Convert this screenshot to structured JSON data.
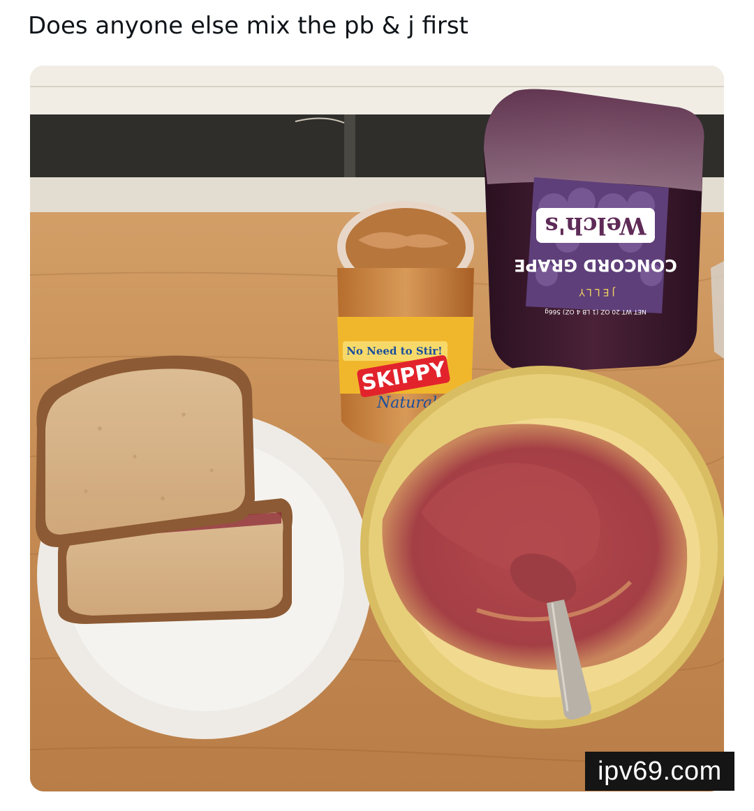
{
  "post": {
    "text": "Does anyone else mix the pb & j first"
  },
  "photo": {
    "jelly_brand": "Welch's",
    "jelly_variety": "CONCORD GRAPE",
    "jelly_type": "JELLY",
    "jelly_weight": "NET WT 20 OZ (1 LB 4 OZ) 566g",
    "pb_tagline": "No Need to Stir!",
    "pb_brand": "SKIPPY",
    "pb_variety": "Natural"
  },
  "watermark": {
    "text": "ipv69.com"
  },
  "colors": {
    "counter": "#c8915a",
    "wall": "#e9e2d5",
    "plate": "#eeebe6",
    "bowl": "#e7cf7a",
    "pbj_mix": "#a8454a",
    "jelly_bottle": "#3e1c30",
    "bread_crust": "#8c5a34",
    "bread_crumb": "#d7b48a"
  }
}
